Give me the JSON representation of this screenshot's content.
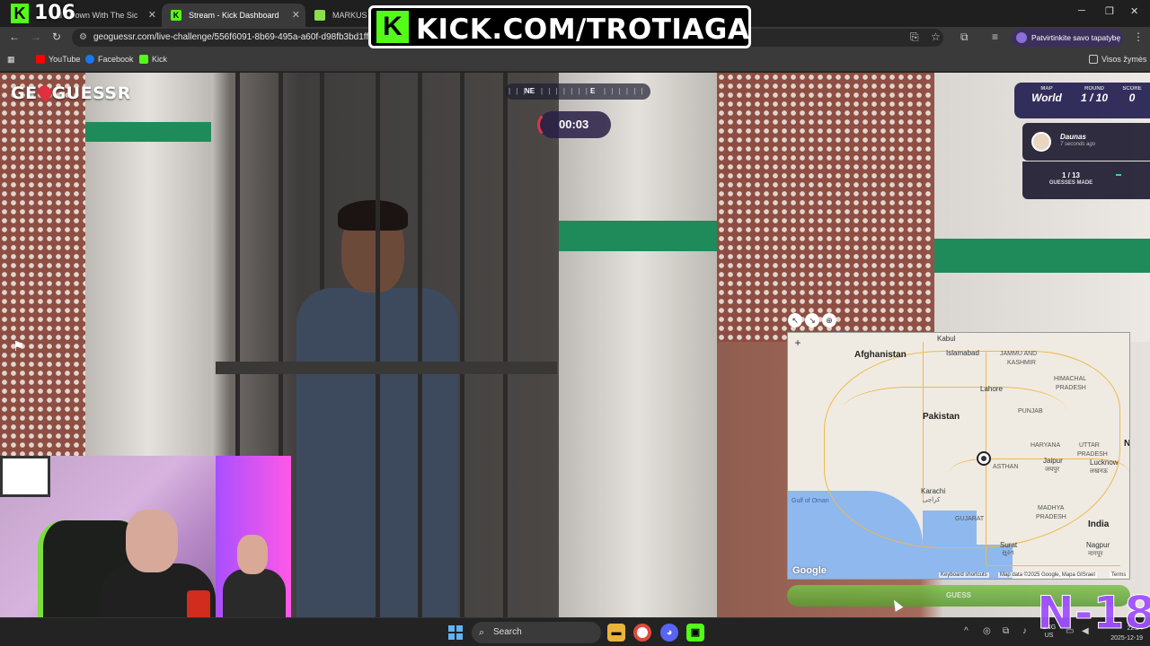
{
  "browser": {
    "tabs": [
      {
        "label": "d - Down With The Sic"
      },
      {
        "label": "Stream - Kick Dashboard"
      },
      {
        "label": "MARKUS bi"
      }
    ],
    "url": "geoguessr.com/live-challenge/556f6091-8b69-495a-a60f-d98fb3bd1ff0",
    "profile_label": "Patvirtinkite savo tapatybę",
    "bookmarks": [
      {
        "label": "YouTube",
        "color": "#ff0000"
      },
      {
        "label": "Facebook",
        "color": "#1877f2"
      },
      {
        "label": "Kick",
        "color": "#53fc18"
      }
    ],
    "all_bookmarks_label": "Visos žymės"
  },
  "overlay": {
    "viewer_count": "106",
    "kick_logo": "K",
    "kick_banner_text": "KICK.COM/TROTIAGA",
    "watermark": "N-18",
    "accent": "#53fc18"
  },
  "game": {
    "logo": {
      "left": "GE",
      "right": "GUESSR"
    },
    "compass": {
      "ne": "NE",
      "e": "E"
    },
    "timer": "00:03",
    "info": {
      "map_label": "MAP",
      "map_value": "World",
      "round_label": "ROUND",
      "round_value": "1 / 10",
      "score_label": "SCORE",
      "score_value": "0"
    },
    "player": {
      "name": "Daunas",
      "time": "7 seconds ago"
    },
    "guesses": {
      "count": "1 / 13",
      "label": "GUESSES MADE"
    },
    "guess_button": "GUESS"
  },
  "map": {
    "labels": {
      "kabul": "Kabul",
      "afghanistan": "Afghanistan",
      "islamabad": "Islamabad",
      "jammu": "JAMMU AND",
      "kashmir": "KASHMIR",
      "lahore": "Lahore",
      "himachal": "HIMACHAL",
      "pradesh": "PRADESH",
      "punjab": "PUNJAB",
      "pakistan": "Pakistan",
      "haryana": "HARYANA",
      "uttar": "UTTAR",
      "pradesh2": "PRADESH",
      "rajasthan": "ASTHAN",
      "jaipur": "Jaipur",
      "jaipur_hi": "जयपुर",
      "lucknow": "Lucknow",
      "lucknow_hi": "लखनऊ",
      "karachi": "Karachi",
      "karachi_ur": "کراچی",
      "gulf": "Gulf of Oman",
      "gujarat": "GUJARAT",
      "madhya": "MADHYA",
      "pradesh3": "PRADESH",
      "india": "India",
      "surat": "Surat",
      "surat_gu": "સુરત",
      "nagpur": "Nagpur",
      "nagpur_hi": "नागपूर",
      "edge_n": "N"
    },
    "google": "Google",
    "footer": {
      "shortcuts": "Keyboard shortcuts",
      "mapdata": "Map data ©2025 Google, Mapa GISrael",
      "terms": "Terms"
    }
  },
  "taskbar": {
    "search": "Search",
    "lang": "ENG",
    "region": "US",
    "time": "22:24",
    "date": "2025-12-19"
  }
}
